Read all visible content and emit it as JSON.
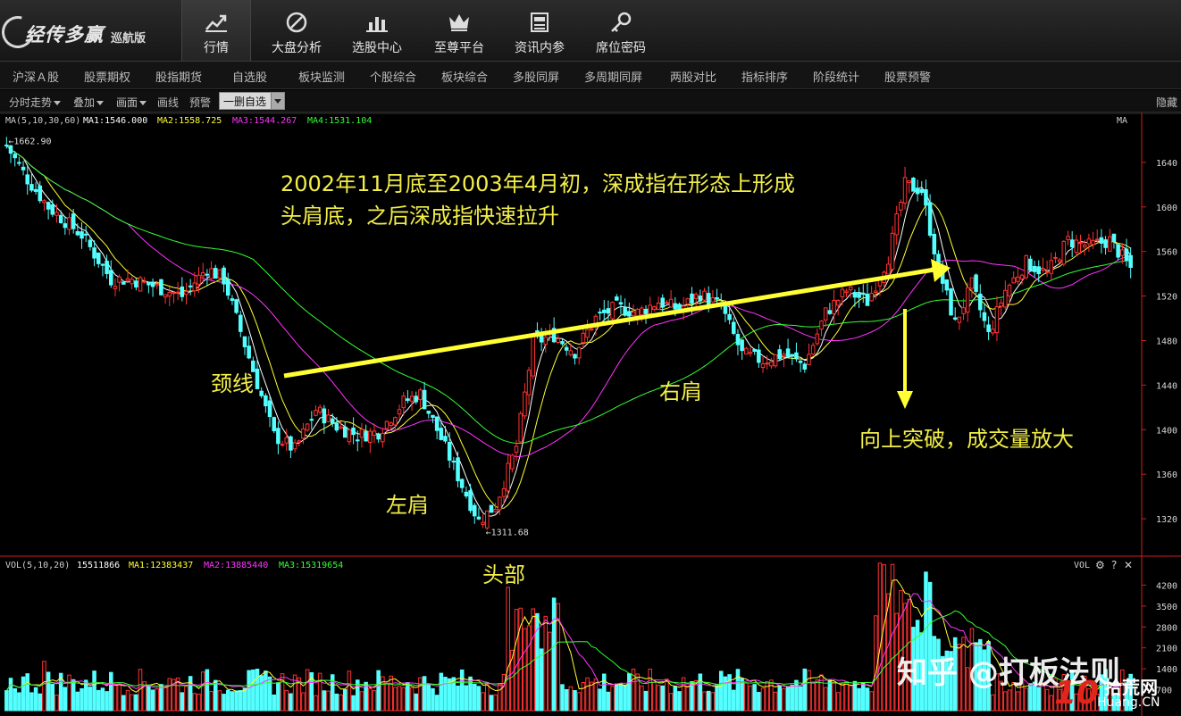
{
  "app": {
    "brand": "经传多赢",
    "edition": "巡航版"
  },
  "nav": [
    {
      "id": "quote",
      "label": "行情",
      "icon": "trend-chart-icon",
      "active": true
    },
    {
      "id": "market",
      "label": "大盘分析",
      "icon": "compass-icon",
      "active": false
    },
    {
      "id": "picker",
      "label": "选股中心",
      "icon": "bar-chart-icon",
      "active": false
    },
    {
      "id": "platform",
      "label": "至尊平台",
      "icon": "crown-icon",
      "active": false
    },
    {
      "id": "news",
      "label": "资讯内参",
      "icon": "document-icon",
      "active": false
    },
    {
      "id": "seat",
      "label": "席位密码",
      "icon": "key-icon",
      "active": false
    }
  ],
  "menu": [
    "沪深Ａ股",
    "股票期权",
    "股指期货",
    "自选股",
    "板块监测",
    "个股综合",
    "板块综合",
    "多股同屏",
    "多周期同屏",
    "两股对比",
    "指标排序",
    "阶段统计",
    "股票预警"
  ],
  "toolbar": {
    "items": [
      "分时走势",
      "叠加",
      "画面",
      "画线",
      "预警"
    ],
    "selector": "一删自选",
    "hide": "隐藏"
  },
  "ma_legend": {
    "prefix": "MA(5,10,30,60)",
    "ma1": "MA1:1546.000",
    "ma2": "MA2:1558.725",
    "ma3": "MA3:1544.267",
    "ma4": "MA4:1531.104",
    "tag": "MA"
  },
  "vol_legend": {
    "prefix": "VOL(5,10,20)",
    "value": "15511866",
    "ma1": "MA1:12383437",
    "ma2": "MA2:13885440",
    "ma3": "MA3:15319654",
    "tag": "VOL"
  },
  "colors": {
    "up": "#ff3232",
    "down": "#54ffff",
    "ma1": "#ffffff",
    "ma2": "#ffff33",
    "ma3": "#ff33ff",
    "ma4": "#33ff33",
    "annotation": "#f2ee48",
    "axis": "#cc2222"
  },
  "annotations": {
    "title_line1": "2002年11月底至2003年4月初，深成指在形态上形成",
    "title_line2": "头肩底，之后深成指快速拉升",
    "neckline": "颈线",
    "left_shoulder": "左肩",
    "head": "头部",
    "right_shoulder": "右肩",
    "breakout": "向上突破，成交量放大"
  },
  "watermark": {
    "text": "知乎 @打板法则",
    "site_num": "10",
    "site_cn": "拾荒网",
    "site_url": "Huang.CN"
  },
  "chart_data": {
    "type": "candlestick",
    "price_axis": {
      "ticks": [
        1320,
        1360,
        1400,
        1440,
        1480,
        1520,
        1560,
        1600,
        1640
      ],
      "range": [
        1300,
        1680
      ]
    },
    "volume_axis": {
      "ticks": [
        700,
        1400,
        2100,
        2800,
        3500,
        4200
      ],
      "range": [
        0,
        4600
      ]
    },
    "high_label": "1662.90",
    "high_value": 1662.9,
    "low_label": "1311.68",
    "low_value": 1311.68,
    "anchors": [
      {
        "i": 0,
        "c": 1655
      },
      {
        "i": 5,
        "c": 1625
      },
      {
        "i": 10,
        "c": 1600
      },
      {
        "i": 18,
        "c": 1575
      },
      {
        "i": 25,
        "c": 1535
      },
      {
        "i": 30,
        "c": 1535
      },
      {
        "i": 36,
        "c": 1528
      },
      {
        "i": 42,
        "c": 1520
      },
      {
        "i": 48,
        "c": 1545
      },
      {
        "i": 52,
        "c": 1535
      },
      {
        "i": 58,
        "c": 1465
      },
      {
        "i": 64,
        "c": 1395
      },
      {
        "i": 69,
        "c": 1382
      },
      {
        "i": 74,
        "c": 1418
      },
      {
        "i": 79,
        "c": 1403
      },
      {
        "i": 84,
        "c": 1395
      },
      {
        "i": 89,
        "c": 1398
      },
      {
        "i": 95,
        "c": 1425
      },
      {
        "i": 99,
        "c": 1432
      },
      {
        "i": 104,
        "c": 1392
      },
      {
        "i": 109,
        "c": 1350
      },
      {
        "i": 113,
        "c": 1318
      },
      {
        "i": 117,
        "c": 1332
      },
      {
        "i": 122,
        "c": 1385
      },
      {
        "i": 126,
        "c": 1478
      },
      {
        "i": 131,
        "c": 1485
      },
      {
        "i": 136,
        "c": 1470
      },
      {
        "i": 141,
        "c": 1500
      },
      {
        "i": 146,
        "c": 1510
      },
      {
        "i": 151,
        "c": 1505
      },
      {
        "i": 156,
        "c": 1515
      },
      {
        "i": 161,
        "c": 1508
      },
      {
        "i": 166,
        "c": 1522
      },
      {
        "i": 171,
        "c": 1510
      },
      {
        "i": 176,
        "c": 1468
      },
      {
        "i": 181,
        "c": 1462
      },
      {
        "i": 186,
        "c": 1468
      },
      {
        "i": 191,
        "c": 1458
      },
      {
        "i": 196,
        "c": 1505
      },
      {
        "i": 201,
        "c": 1525
      },
      {
        "i": 206,
        "c": 1515
      },
      {
        "i": 211,
        "c": 1555
      },
      {
        "i": 215,
        "c": 1620
      },
      {
        "i": 219,
        "c": 1615
      },
      {
        "i": 223,
        "c": 1545
      },
      {
        "i": 227,
        "c": 1495
      },
      {
        "i": 231,
        "c": 1530
      },
      {
        "i": 235,
        "c": 1485
      },
      {
        "i": 239,
        "c": 1525
      },
      {
        "i": 244,
        "c": 1550
      },
      {
        "i": 249,
        "c": 1540
      },
      {
        "i": 254,
        "c": 1570
      },
      {
        "i": 259,
        "c": 1565
      },
      {
        "i": 264,
        "c": 1570
      },
      {
        "i": 269,
        "c": 1545
      }
    ],
    "count": 270
  }
}
